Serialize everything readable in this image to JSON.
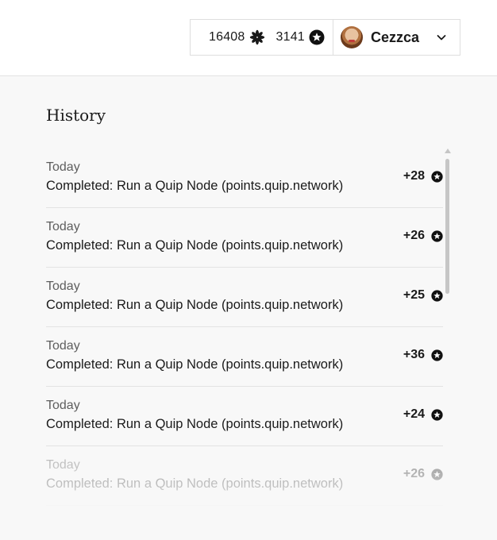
{
  "header": {
    "points_total": "16408",
    "points_icon": "asterisk-flower-icon",
    "stars_total": "3141",
    "stars_icon": "star-badge-icon",
    "user": {
      "name": "Cezzca",
      "avatar_icon": "user-avatar",
      "menu_icon": "chevron-down-icon"
    }
  },
  "history": {
    "title": "History",
    "items": [
      {
        "date": "Today",
        "description": "Completed: Run a Quip Node (points.quip.network)",
        "points": "+28",
        "icon": "star-badge-icon"
      },
      {
        "date": "Today",
        "description": "Completed: Run a Quip Node (points.quip.network)",
        "points": "+26",
        "icon": "star-badge-icon"
      },
      {
        "date": "Today",
        "description": "Completed: Run a Quip Node (points.quip.network)",
        "points": "+25",
        "icon": "star-badge-icon"
      },
      {
        "date": "Today",
        "description": "Completed: Run a Quip Node (points.quip.network)",
        "points": "+36",
        "icon": "star-badge-icon"
      },
      {
        "date": "Today",
        "description": "Completed: Run a Quip Node (points.quip.network)",
        "points": "+24",
        "icon": "star-badge-icon"
      },
      {
        "date": "Today",
        "description": "Completed: Run a Quip Node (points.quip.network)",
        "points": "+26",
        "icon": "star-badge-icon"
      }
    ]
  },
  "colors": {
    "text": "#1a1a1a",
    "muted": "#5e5e5e",
    "background": "#f8f8f8",
    "header_bg": "#ffffff",
    "border": "#e3e3e3"
  }
}
